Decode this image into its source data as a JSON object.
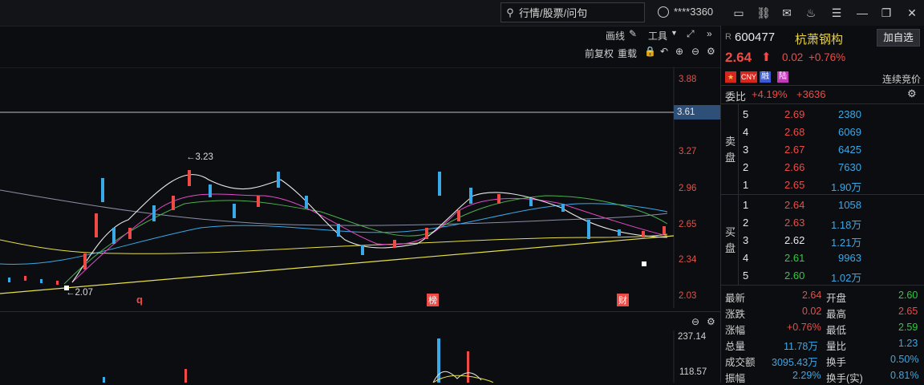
{
  "topbar": {
    "search_placeholder": "行情/股票/问句",
    "user_name": "****3360"
  },
  "chart_toolbar": {
    "draw_label": "画线",
    "tools_label": "工具",
    "adjust_label": "前复权",
    "reload_label": "重载"
  },
  "price_axis": [
    "3.88",
    "3.61",
    "3.27",
    "2.96",
    "2.65",
    "2.34",
    "2.03"
  ],
  "volume_axis": [
    "237.14",
    "118.57"
  ],
  "annotations": {
    "high": "←3.23",
    "low": "←2.07",
    "marker_q": "q",
    "marker_bang": "榜",
    "marker_cai": "财"
  },
  "stock": {
    "r_tag": "R",
    "code": "600477",
    "name": "杭萧钢构",
    "add_label": "加自选",
    "price": "2.64",
    "change": "0.02",
    "change_pct": "+0.76%",
    "flag_cny": "CNY",
    "flag_rong": "融",
    "flag_lu": "陆",
    "auction": "连续竞价",
    "ratio_label": "委比",
    "ratio_pct": "+4.19%",
    "ratio_diff": "+3636",
    "sell_label_1": "卖",
    "sell_label_2": "盘",
    "buy_label_1": "买",
    "buy_label_2": "盘"
  },
  "sell_orders": [
    {
      "level": "5",
      "price": "2.69",
      "volume": "2380"
    },
    {
      "level": "4",
      "price": "2.68",
      "volume": "6069"
    },
    {
      "level": "3",
      "price": "2.67",
      "volume": "6425"
    },
    {
      "level": "2",
      "price": "2.66",
      "volume": "7630"
    },
    {
      "level": "1",
      "price": "2.65",
      "volume": "1.90万"
    }
  ],
  "buy_orders": [
    {
      "level": "1",
      "price": "2.64",
      "volume": "1058"
    },
    {
      "level": "2",
      "price": "2.63",
      "volume": "1.18万"
    },
    {
      "level": "3",
      "price": "2.62",
      "volume": "1.21万"
    },
    {
      "level": "4",
      "price": "2.61",
      "volume": "9963"
    },
    {
      "level": "5",
      "price": "2.60",
      "volume": "1.02万"
    }
  ],
  "stats": [
    {
      "l1": "最新",
      "v1": "2.64",
      "l2": "开盘",
      "v2": "2.60"
    },
    {
      "l1": "涨跌",
      "v1": "0.02",
      "l2": "最高",
      "v2": "2.65"
    },
    {
      "l1": "涨幅",
      "v1": "+0.76%",
      "l2": "最低",
      "v2": "2.59"
    },
    {
      "l1": "总量",
      "v1": "11.78万",
      "l2": "量比",
      "v2": "1.23"
    },
    {
      "l1": "成交额",
      "v1": "3095.43万",
      "l2": "换手",
      "v2": "0.50%"
    },
    {
      "l1": "振幅",
      "v1": "2.29%",
      "l2": "换手(实)",
      "v2": "0.81%"
    }
  ],
  "colors": {
    "up": "#ef4b46",
    "down": "#2ecc40",
    "accent": "#39a9e8"
  }
}
